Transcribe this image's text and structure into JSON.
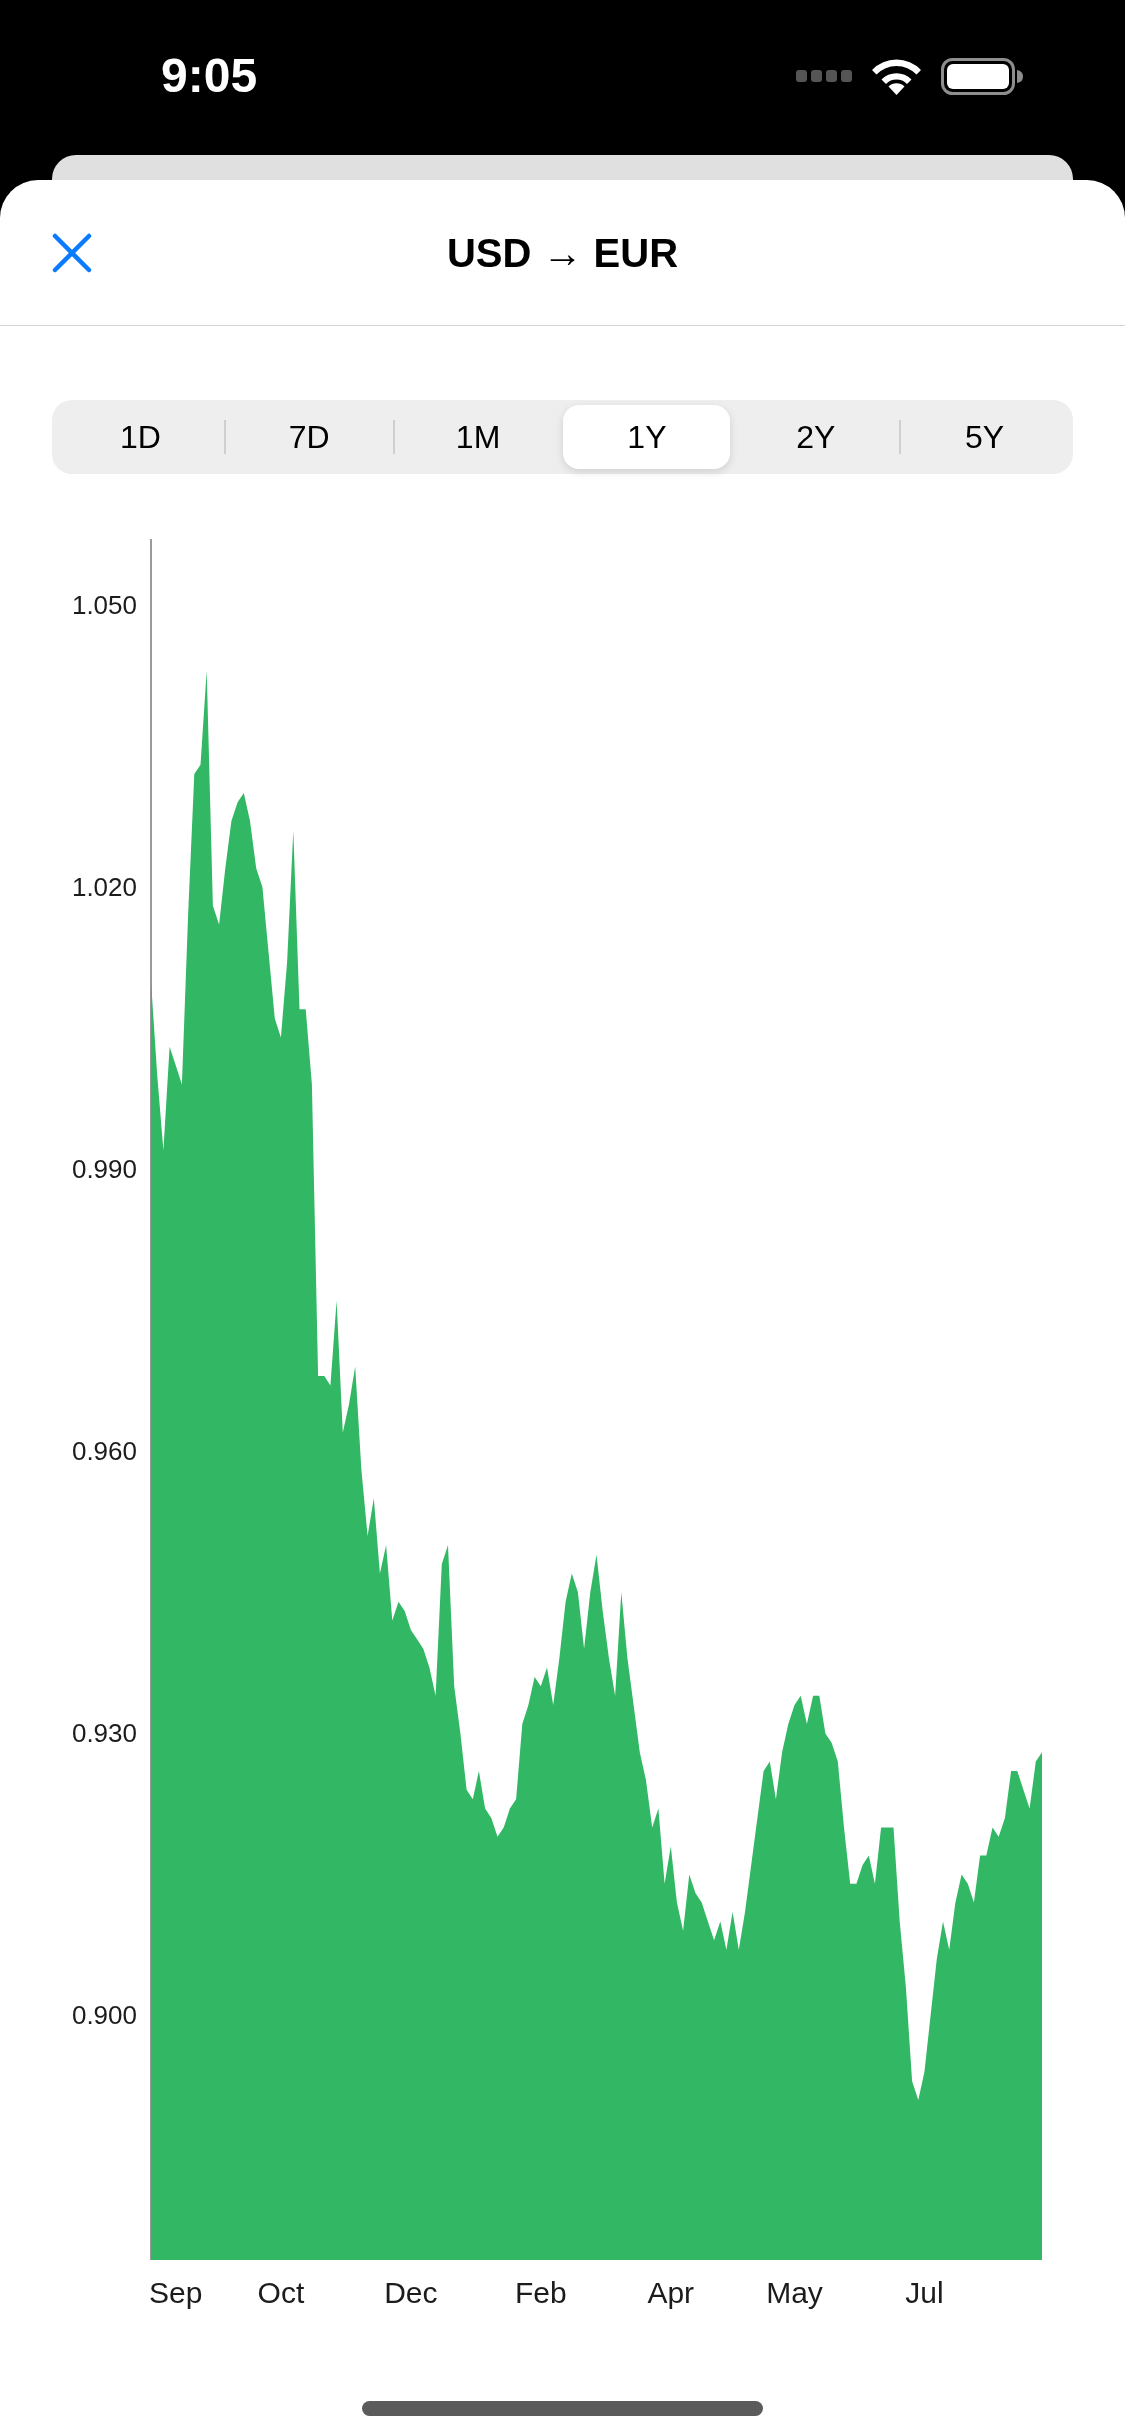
{
  "status_bar": {
    "time": "9:05"
  },
  "header": {
    "title": "USD → EUR"
  },
  "range_tabs": [
    {
      "label": "1D",
      "selected": false
    },
    {
      "label": "7D",
      "selected": false
    },
    {
      "label": "1M",
      "selected": false
    },
    {
      "label": "1Y",
      "selected": true
    },
    {
      "label": "2Y",
      "selected": false
    },
    {
      "label": "5Y",
      "selected": false
    }
  ],
  "chart": {
    "chart_data": {
      "type": "area",
      "categories": [
        null,
        null,
        null,
        null,
        "Sep",
        null,
        null,
        null,
        null,
        null,
        null,
        null,
        null,
        null,
        null,
        null,
        null,
        null,
        null,
        null,
        null,
        "Oct",
        null,
        null,
        null,
        null,
        null,
        null,
        null,
        null,
        null,
        null,
        null,
        null,
        null,
        null,
        null,
        null,
        null,
        null,
        null,
        null,
        "Dec",
        null,
        null,
        null,
        null,
        null,
        null,
        null,
        null,
        null,
        null,
        null,
        null,
        null,
        null,
        null,
        null,
        null,
        null,
        null,
        null,
        "Feb",
        null,
        null,
        null,
        null,
        null,
        null,
        null,
        null,
        null,
        null,
        null,
        null,
        null,
        null,
        null,
        null,
        null,
        null,
        null,
        null,
        "Apr",
        null,
        null,
        null,
        null,
        null,
        null,
        null,
        null,
        null,
        null,
        null,
        null,
        null,
        null,
        null,
        null,
        null,
        null,
        null,
        "May",
        null,
        null,
        null,
        null,
        null,
        null,
        null,
        null,
        null,
        null,
        null,
        null,
        null,
        null,
        null,
        null,
        null,
        null,
        null,
        null,
        "Jul",
        null,
        null,
        null,
        null,
        null,
        null,
        null,
        null,
        null,
        null,
        null,
        null,
        null,
        null,
        null,
        null,
        null,
        null,
        null
      ],
      "series": [
        {
          "color": "#32b864",
          "values": [
            1.01,
            1.0,
            0.992,
            1.003,
            1.001,
            0.999,
            1.017,
            1.032,
            1.033,
            1.043,
            1.018,
            1.016,
            1.022,
            1.027,
            1.029,
            1.03,
            1.027,
            1.022,
            1.02,
            1.013,
            1.006,
            1.004,
            1.012,
            1.026,
            1.007,
            1.007,
            0.999,
            0.968,
            0.968,
            0.967,
            0.976,
            0.962,
            0.965,
            0.969,
            0.958,
            0.951,
            0.955,
            0.947,
            0.95,
            0.942,
            0.944,
            0.943,
            0.941,
            0.94,
            0.939,
            0.937,
            0.934,
            0.948,
            0.95,
            0.935,
            0.93,
            0.924,
            0.923,
            0.926,
            0.922,
            0.921,
            0.919,
            0.92,
            0.922,
            0.923,
            0.931,
            0.933,
            0.936,
            0.935,
            0.937,
            0.933,
            0.938,
            0.944,
            0.947,
            0.945,
            0.939,
            0.945,
            0.949,
            0.943,
            0.938,
            0.934,
            0.945,
            0.938,
            0.933,
            0.928,
            0.925,
            0.92,
            0.922,
            0.914,
            0.918,
            0.912,
            0.909,
            0.915,
            0.913,
            0.912,
            0.91,
            0.908,
            0.91,
            0.907,
            0.911,
            0.907,
            0.911,
            0.916,
            0.921,
            0.926,
            0.927,
            0.923,
            0.928,
            0.931,
            0.933,
            0.934,
            0.931,
            0.934,
            0.934,
            0.93,
            0.929,
            0.927,
            0.92,
            0.914,
            0.914,
            0.916,
            0.917,
            0.914,
            0.92,
            0.92,
            0.92,
            0.91,
            0.903,
            0.893,
            0.891,
            0.894,
            0.9,
            0.906,
            0.91,
            0.907,
            0.912,
            0.915,
            0.914,
            0.912,
            0.917,
            0.917,
            0.92,
            0.919,
            0.921,
            0.926,
            0.926,
            0.924,
            0.922,
            0.927,
            0.928
          ]
        }
      ],
      "ylim": [
        0.874,
        1.057
      ],
      "yticks": [
        {
          "value": 1.05,
          "label": "1.050"
        },
        {
          "value": 1.02,
          "label": "1.020"
        },
        {
          "value": 0.99,
          "label": "0.990"
        },
        {
          "value": 0.96,
          "label": "0.960"
        },
        {
          "value": 0.93,
          "label": "0.930"
        },
        {
          "value": 0.9,
          "label": "0.900"
        }
      ]
    }
  }
}
